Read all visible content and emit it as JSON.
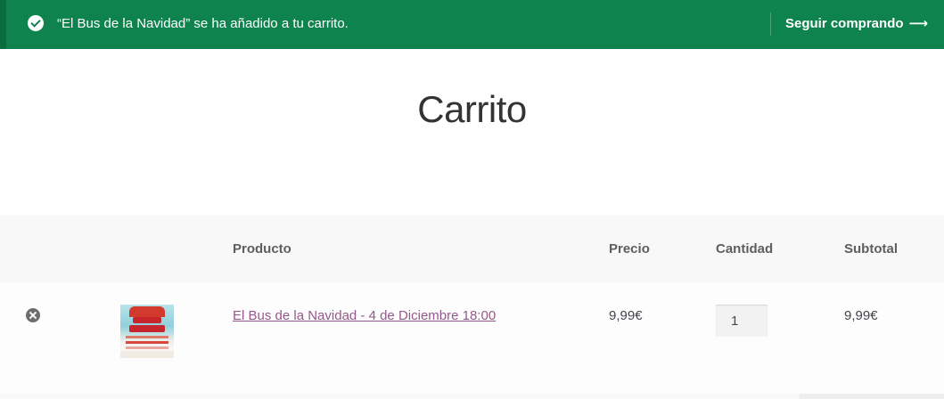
{
  "notice": {
    "message": "“El Bus de la Navidad” se ha añadido a tu carrito.",
    "continue_label": "Seguir comprando",
    "continue_arrow": "⟶",
    "icon": "check-circle-icon",
    "background_color": "#0f834d"
  },
  "page": {
    "title": "Carrito"
  },
  "cart_table": {
    "headers": {
      "product": "Producto",
      "price": "Precio",
      "quantity": "Cantidad",
      "subtotal": "Subtotal"
    },
    "rows": [
      {
        "remove_icon": "remove-circle-icon",
        "thumbnail": "el-bus-de-la-navidad-poster",
        "product_name": "El Bus de la Navidad - 4 de Diciembre 18:00",
        "price": "9,99€",
        "quantity": "1",
        "subtotal": "9,99€"
      }
    ]
  },
  "colors": {
    "link": "#96588a",
    "header_bg": "#f8f8f8"
  }
}
